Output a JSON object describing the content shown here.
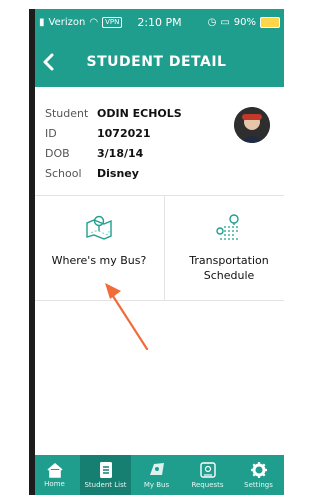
{
  "status_bar": {
    "carrier": "Verizon",
    "vpn": "VPN",
    "time": "2:10 PM",
    "battery": "90%"
  },
  "header": {
    "title": "STUDENT DETAIL"
  },
  "student": {
    "fields": [
      {
        "label": "Student",
        "value": "ODIN ECHOLS"
      },
      {
        "label": "ID",
        "value": "1072021"
      },
      {
        "label": "DOB",
        "value": "3/18/14"
      },
      {
        "label": "School",
        "value": "Disney"
      }
    ]
  },
  "tiles": [
    {
      "label": "Where's my Bus?",
      "icon": "map-pin-icon"
    },
    {
      "label": "Transportation Schedule",
      "icon": "route-icon"
    }
  ],
  "tabbar": {
    "items": [
      {
        "label": "Home",
        "icon": "home-icon"
      },
      {
        "label": "Student List",
        "icon": "list-icon"
      },
      {
        "label": "My Bus",
        "icon": "bus-map-icon"
      },
      {
        "label": "Requests",
        "icon": "requests-icon"
      },
      {
        "label": "Settings",
        "icon": "gear-icon"
      }
    ],
    "active_index": 1
  },
  "colors": {
    "brand": "#1f9e8e",
    "tab_active": "#167f72",
    "annotation_arrow": "#f26b3a"
  }
}
